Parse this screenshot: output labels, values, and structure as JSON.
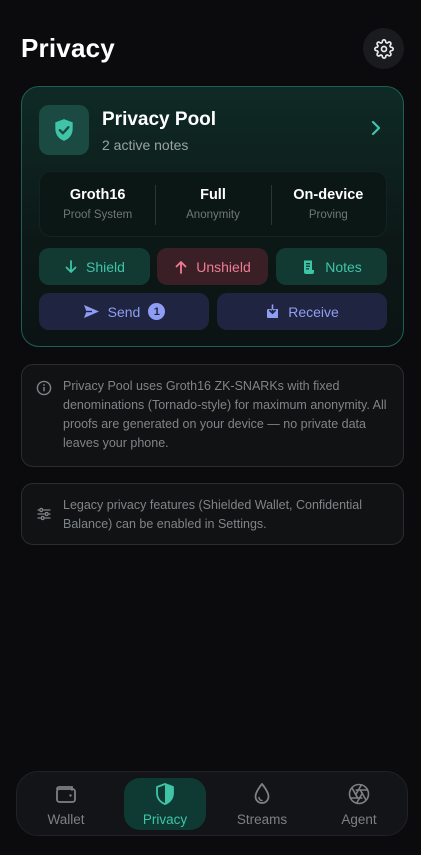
{
  "header": {
    "title": "Privacy"
  },
  "pool": {
    "title": "Privacy Pool",
    "subtitle": "2 active notes",
    "stats": [
      {
        "value": "Groth16",
        "label": "Proof System"
      },
      {
        "value": "Full",
        "label": "Anonymity"
      },
      {
        "value": "On-device",
        "label": "Proving"
      }
    ],
    "actions": {
      "shield": "Shield",
      "unshield": "Unshield",
      "notes": "Notes",
      "send": "Send",
      "send_badge": "1",
      "receive": "Receive"
    }
  },
  "info": {
    "pool_text": "Privacy Pool uses Groth16 ZK-SNARKs with fixed denominations (Tornado-style) for maximum anonymity. All proofs are generated on your device — no private data leaves your phone.",
    "legacy_text": "Legacy privacy features (Shielded Wallet, Confidential Balance) can be enabled in Settings."
  },
  "nav": {
    "items": [
      {
        "label": "Wallet",
        "icon": "wallet-icon"
      },
      {
        "label": "Privacy",
        "icon": "shield-icon",
        "active": true
      },
      {
        "label": "Streams",
        "icon": "droplet-icon"
      },
      {
        "label": "Agent",
        "icon": "aperture-icon"
      }
    ]
  },
  "colors": {
    "accent_teal": "#3fc4a8",
    "accent_pink": "#f07c93",
    "accent_indigo": "#8f9df5",
    "background": "#0b0b0d"
  }
}
